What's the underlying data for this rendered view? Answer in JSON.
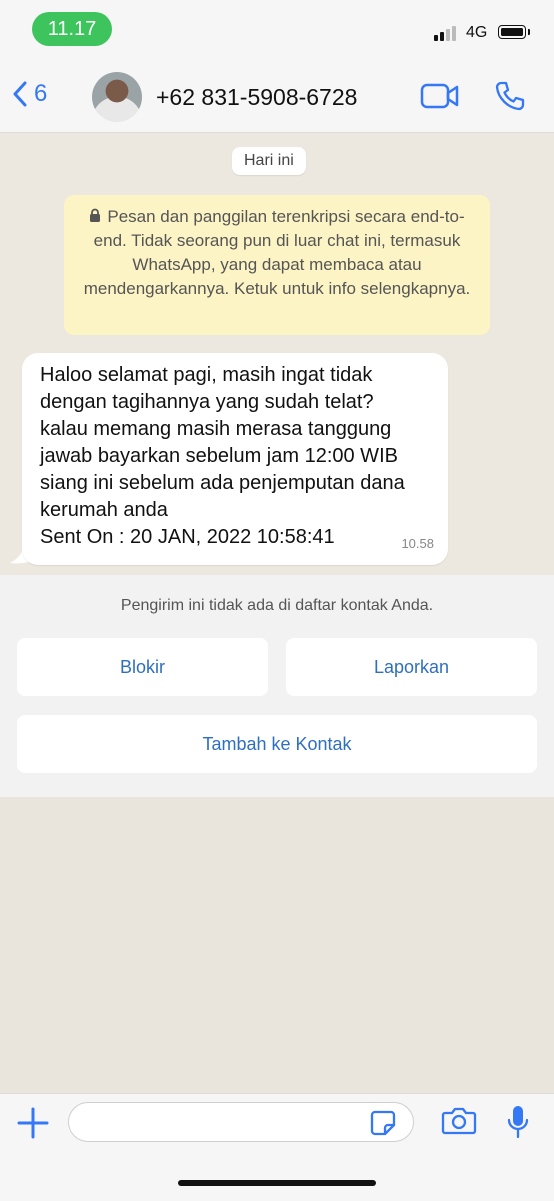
{
  "status_bar": {
    "time": "11.17",
    "network": "4G"
  },
  "header": {
    "back_count": "6",
    "contact": "+62 831-5908-6728"
  },
  "chat": {
    "date_chip": "Hari ini",
    "encryption_notice": "Pesan dan panggilan terenkripsi secara end-to-end. Tidak seorang pun di luar chat ini, termasuk WhatsApp, yang dapat membaca atau mendengarkannya. Ketuk untuk info selengkapnya.",
    "message": {
      "text": "Haloo selamat pagi, masih ingat tidak\ndengan tagihannya yang sudah telat?\nkalau memang masih merasa tanggung\njawab bayarkan sebelum jam 12:00 WIB\nsiang ini sebelum ada penjemputan dana\nkerumah anda\nSent On : 20 JAN, 2022 10:58:41",
      "time": "10.58"
    }
  },
  "unknown_sender": {
    "notice": "Pengirim ini tidak ada di daftar kontak Anda.",
    "block_label": "Blokir",
    "report_label": "Laporkan",
    "add_contact_label": "Tambah ke Kontak"
  },
  "colors": {
    "accent": "#3478f6",
    "status_pill": "#3ec45c",
    "notice_bg": "#fdf4c5",
    "button_text": "#2f6fc0"
  },
  "icons": [
    "back-chevron-icon",
    "video-call-icon",
    "voice-call-icon",
    "lock-icon",
    "plus-icon",
    "sticker-icon",
    "camera-icon",
    "microphone-icon"
  ]
}
